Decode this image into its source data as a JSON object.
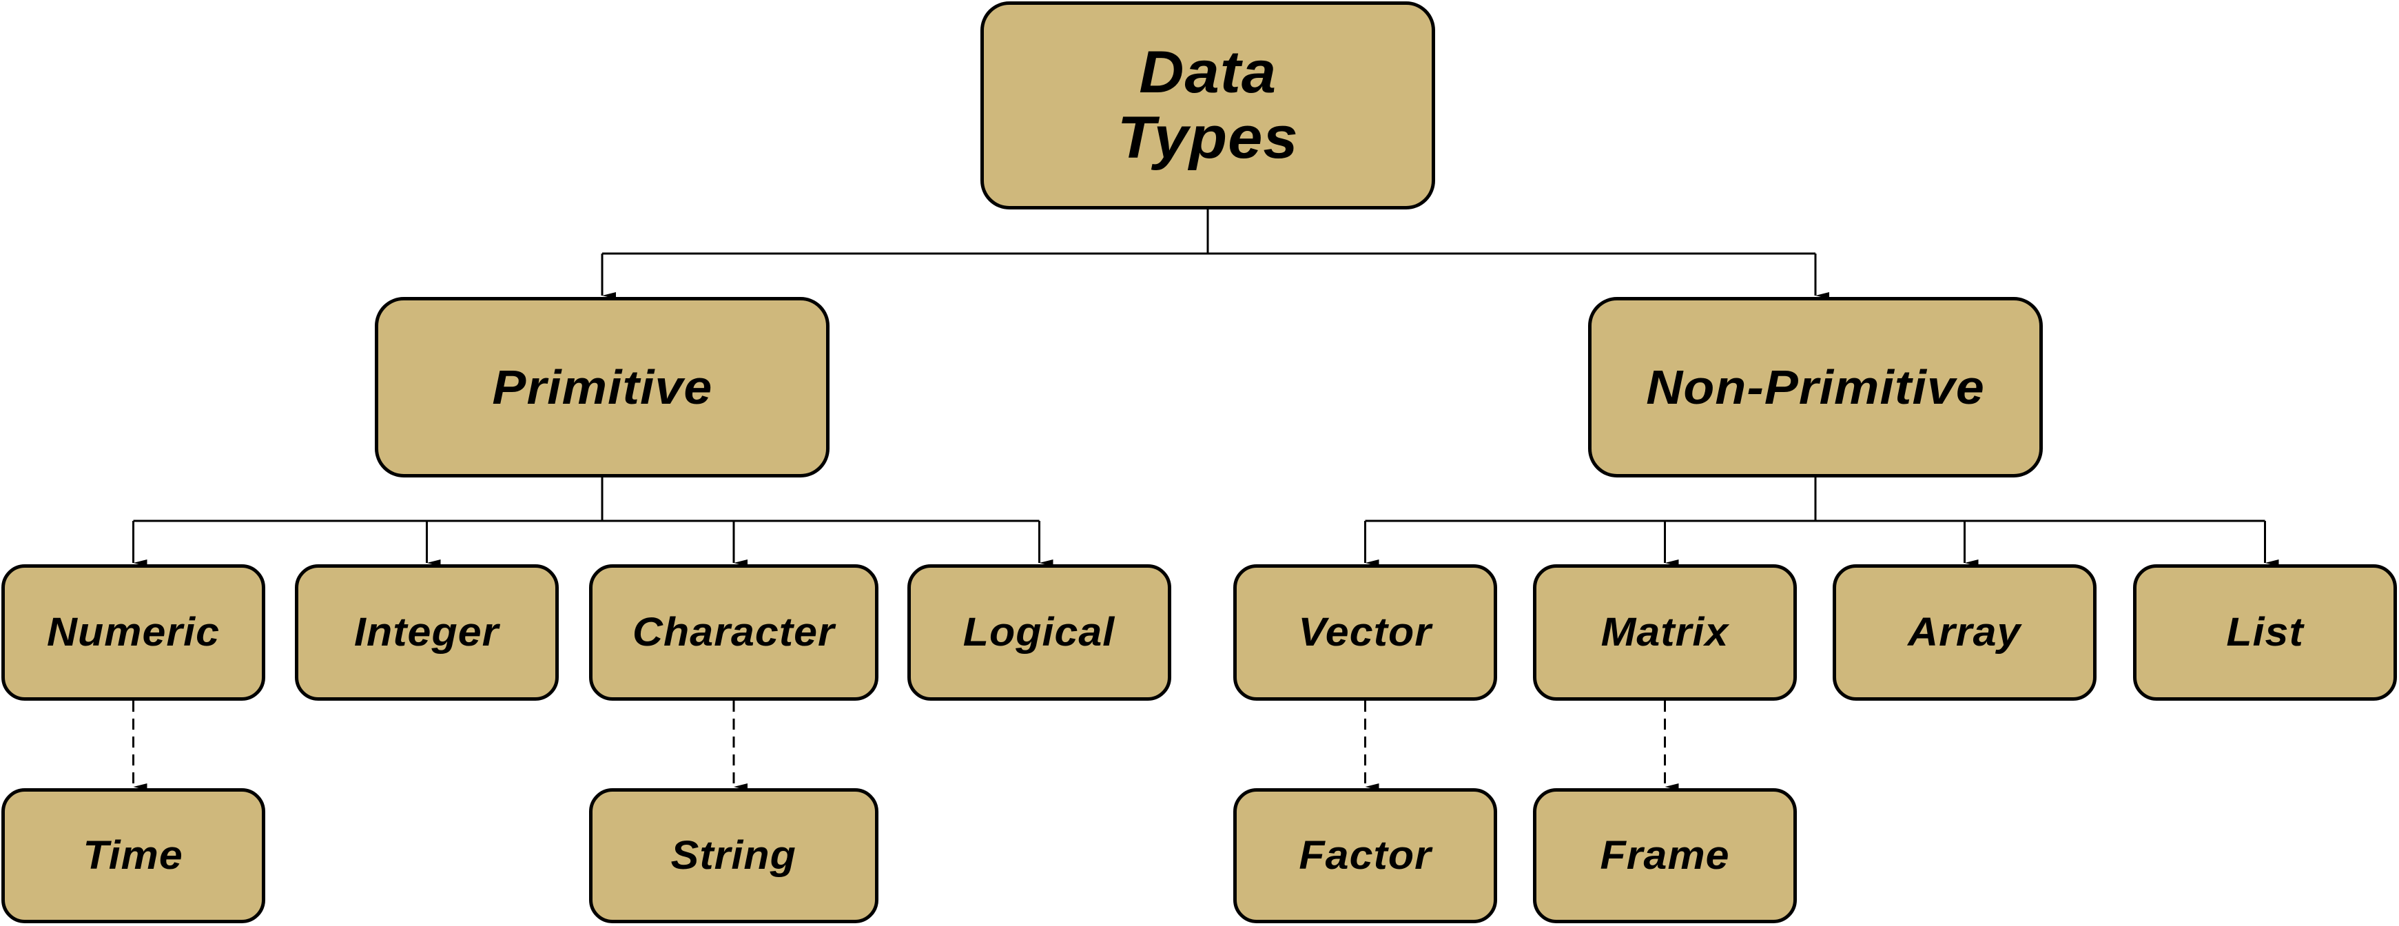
{
  "diagram": {
    "title": "Data Types",
    "colors": {
      "node_fill": "#CFB87C",
      "node_border": "#000000",
      "connector": "#000000",
      "background": "#FFFFFF"
    },
    "root": {
      "id": "data-types",
      "label": "Data\nTypes"
    },
    "categories": [
      {
        "id": "primitive",
        "label": "Primitive",
        "children": [
          {
            "id": "numeric",
            "label": "Numeric",
            "derived": {
              "id": "time",
              "label": "Time"
            }
          },
          {
            "id": "integer",
            "label": "Integer"
          },
          {
            "id": "character",
            "label": "Character",
            "derived": {
              "id": "string",
              "label": "String"
            }
          },
          {
            "id": "logical",
            "label": "Logical"
          }
        ]
      },
      {
        "id": "non-primitive",
        "label": "Non-Primitive",
        "children": [
          {
            "id": "vector",
            "label": "Vector",
            "derived": {
              "id": "factor",
              "label": "Factor"
            }
          },
          {
            "id": "matrix",
            "label": "Matrix",
            "derived": {
              "id": "frame",
              "label": "Frame"
            }
          },
          {
            "id": "array",
            "label": "Array"
          },
          {
            "id": "list",
            "label": "List"
          }
        ]
      }
    ],
    "edge_styles": {
      "hierarchy": "solid-arrow",
      "derived": "dashed-arrow"
    }
  }
}
